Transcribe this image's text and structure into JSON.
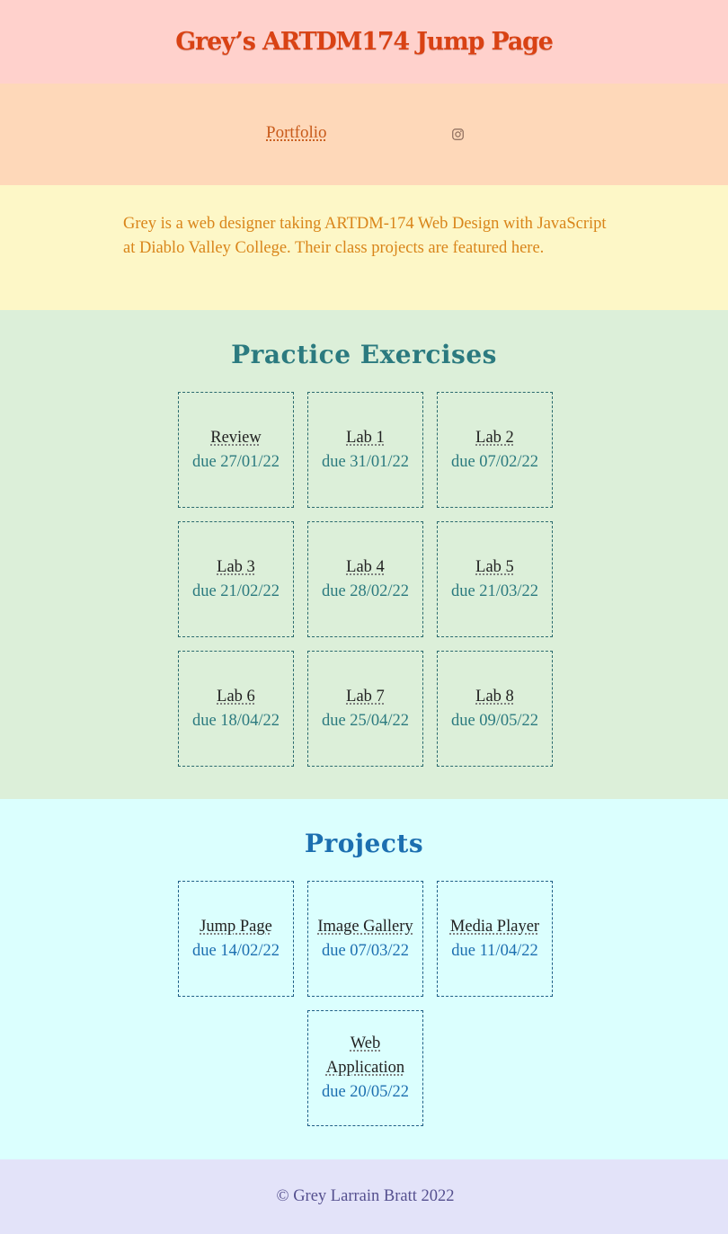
{
  "header": {
    "title": "Grey’s ARTDM174 Jump Page"
  },
  "nav": {
    "portfolio_label": "Portfolio",
    "instagram_icon": "instagram-icon"
  },
  "about": {
    "text": "Grey is a web designer taking ARTDM-174 Web Design with JavaScript at Diablo Valley College. Their class projects are featured here."
  },
  "practice": {
    "title": "Practice Exercises",
    "items": [
      {
        "name": "Review",
        "due": "due 27/01/22"
      },
      {
        "name": "Lab 1",
        "due": "due 31/01/22"
      },
      {
        "name": "Lab 2",
        "due": "due 07/02/22"
      },
      {
        "name": "Lab 3",
        "due": "due 21/02/22"
      },
      {
        "name": "Lab 4",
        "due": "due 28/02/22"
      },
      {
        "name": "Lab 5",
        "due": "due 21/03/22"
      },
      {
        "name": "Lab 6",
        "due": "due 18/04/22"
      },
      {
        "name": "Lab 7",
        "due": "due 25/04/22"
      },
      {
        "name": "Lab 8",
        "due": "due 09/05/22"
      }
    ]
  },
  "projects": {
    "title": "Projects",
    "items": [
      {
        "name": "Jump Page",
        "due": "due 14/02/22"
      },
      {
        "name": "Image Gallery",
        "due": "due 07/03/22"
      },
      {
        "name": "Media Player",
        "due": "due 11/04/22"
      },
      {
        "name": "Web Application",
        "due": "due 20/05/22"
      }
    ]
  },
  "footer": {
    "text": "© Grey Larrain Bratt 2022"
  },
  "colors": {
    "header_bg": "#ffd1cc",
    "nav_bg": "#fed8b9",
    "about_bg": "#fdf7c7",
    "practice_bg": "#dcefd9",
    "projects_bg": "#dbfffe",
    "footer_bg": "#e3e3f9"
  }
}
